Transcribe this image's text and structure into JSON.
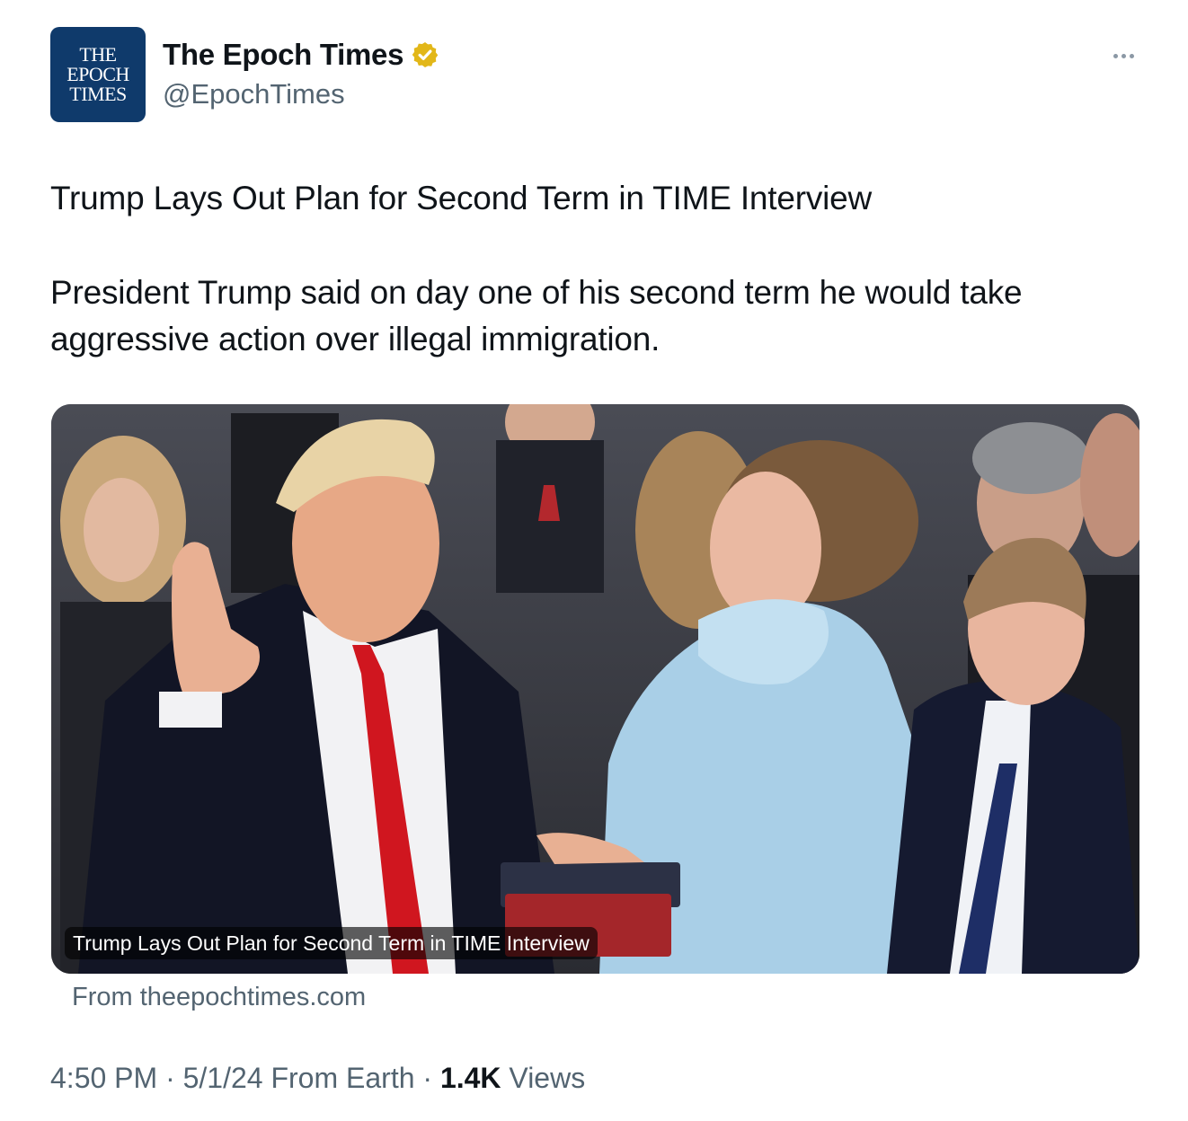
{
  "account": {
    "avatar_lines": [
      "THE",
      "EPOCH",
      "TIMES"
    ],
    "display_name": "The Epoch Times",
    "handle": "@EpochTimes",
    "verified": true,
    "verified_color": "#e2b719"
  },
  "icons": {
    "more": "more-horizontal-icon",
    "verified": "verified-badge-icon"
  },
  "post": {
    "headline": "Trump Lays Out Plan for Second Term in TIME Interview",
    "body": "President Trump said on day one of his second term he would take aggressive action over illegal immigration."
  },
  "card": {
    "image_caption": "Trump Lays Out Plan for Second Term in TIME Interview",
    "source": "From theepochtimes.com"
  },
  "meta": {
    "time": "4:50 PM",
    "date": "5/1/24",
    "client": "From Earth",
    "separator": " · ",
    "views_count": "1.4K",
    "views_label": "Views"
  },
  "colors": {
    "avatar_bg": "#0f3a6b",
    "secondary_text": "#536471",
    "primary_text": "#0f1419"
  }
}
